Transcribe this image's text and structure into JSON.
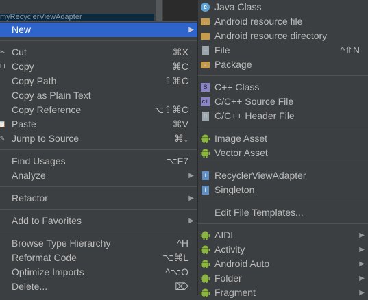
{
  "background": {
    "selected_row": "myRecyclerViewAdapter"
  },
  "left_menu": {
    "items": [
      {
        "label": "New",
        "arrow": true,
        "selected": true
      },
      {
        "sep": true
      },
      {
        "label": "Cut",
        "shortcut": "⌘X",
        "icon": "scissors-icon"
      },
      {
        "label": "Copy",
        "shortcut": "⌘C",
        "icon": "copy-icon"
      },
      {
        "label": "Copy Path",
        "shortcut": "⇧⌘C"
      },
      {
        "label": "Copy as Plain Text"
      },
      {
        "label": "Copy Reference",
        "shortcut": "⌥⇧⌘C"
      },
      {
        "label": "Paste",
        "shortcut": "⌘V",
        "icon": "paste-icon"
      },
      {
        "label": "Jump to Source",
        "shortcut": "⌘↓",
        "icon": "edit-source-icon"
      },
      {
        "sep": true
      },
      {
        "label": "Find Usages",
        "shortcut": "⌥F7"
      },
      {
        "label": "Analyze",
        "arrow": true
      },
      {
        "sep": true
      },
      {
        "label": "Refactor",
        "arrow": true
      },
      {
        "sep": true
      },
      {
        "label": "Add to Favorites",
        "arrow": true
      },
      {
        "sep": true
      },
      {
        "label": "Browse Type Hierarchy",
        "shortcut": "^H"
      },
      {
        "label": "Reformat Code",
        "shortcut": "⌥⌘L"
      },
      {
        "label": "Optimize Imports",
        "shortcut": "^⌥O"
      },
      {
        "label": "Delete...",
        "shortcut": "⌦"
      }
    ]
  },
  "sub_menu": {
    "items": [
      {
        "label": "Java Class",
        "icon": "java-class-icon"
      },
      {
        "label": "Android resource file",
        "icon": "resource-file-icon"
      },
      {
        "label": "Android resource directory",
        "icon": "folder-icon"
      },
      {
        "label": "File",
        "shortcut": "^⇧N",
        "icon": "file-icon"
      },
      {
        "label": "Package",
        "icon": "package-icon"
      },
      {
        "sep": true
      },
      {
        "label": "C++ Class",
        "icon": "cpp-class-icon"
      },
      {
        "label": "C/C++ Source File",
        "icon": "cpp-source-icon"
      },
      {
        "label": "C/C++ Header File",
        "icon": "cpp-header-icon"
      },
      {
        "sep": true
      },
      {
        "label": "Image Asset",
        "icon": "android-icon"
      },
      {
        "label": "Vector Asset",
        "icon": "android-icon"
      },
      {
        "sep": true
      },
      {
        "label": "RecyclerViewAdapter",
        "icon": "template-icon"
      },
      {
        "label": "Singleton",
        "icon": "template-icon"
      },
      {
        "sep": true
      },
      {
        "label": "Edit File Templates..."
      },
      {
        "sep": true
      },
      {
        "label": "AIDL",
        "icon": "android-icon",
        "arrow": true
      },
      {
        "label": "Activity",
        "icon": "android-icon",
        "arrow": true
      },
      {
        "label": "Android Auto",
        "icon": "android-icon",
        "arrow": true
      },
      {
        "label": "Folder",
        "icon": "android-icon",
        "arrow": true
      },
      {
        "label": "Fragment",
        "icon": "android-icon",
        "arrow": true
      }
    ]
  },
  "colors": {
    "menu_bg": "#3c3f41",
    "highlight": "#2f65ca",
    "text": "#bbbbbb"
  }
}
